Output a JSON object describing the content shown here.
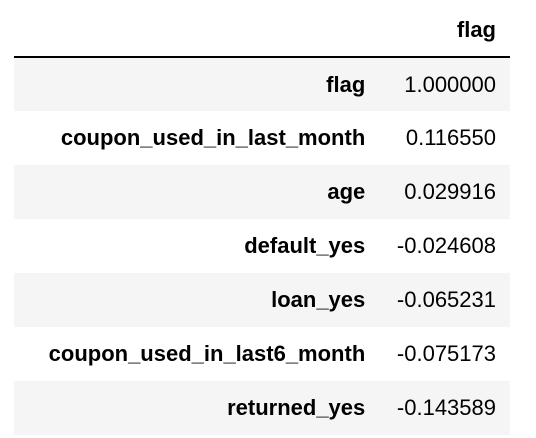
{
  "table": {
    "columns": [
      "",
      "flag"
    ],
    "rows": [
      {
        "index": "flag",
        "value": "1.000000"
      },
      {
        "index": "coupon_used_in_last_month",
        "value": "0.116550"
      },
      {
        "index": "age",
        "value": "0.029916"
      },
      {
        "index": "default_yes",
        "value": "-0.024608"
      },
      {
        "index": "loan_yes",
        "value": "-0.065231"
      },
      {
        "index": "coupon_used_in_last6_month",
        "value": "-0.075173"
      },
      {
        "index": "returned_yes",
        "value": "-0.143589"
      }
    ]
  },
  "colors": {
    "stripe": "#f5f5f5",
    "background": "#ffffff",
    "text": "#000000",
    "header_rule": "#000000"
  }
}
